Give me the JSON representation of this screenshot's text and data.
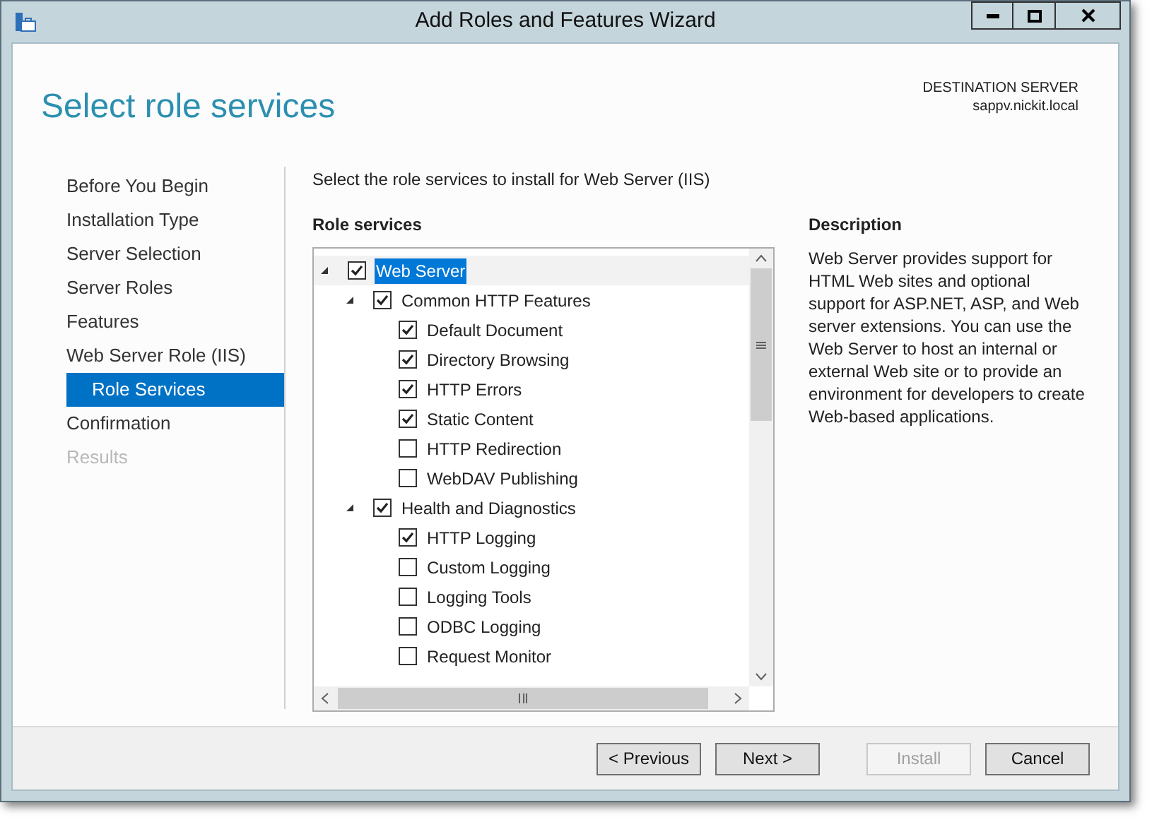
{
  "window": {
    "title": "Add Roles and Features Wizard"
  },
  "header": {
    "title": "Select role services",
    "destination_label": "DESTINATION SERVER",
    "destination_server": "sappv.nickit.local"
  },
  "nav": [
    {
      "label": "Before You Begin",
      "selected": false,
      "disabled": false
    },
    {
      "label": "Installation Type",
      "selected": false,
      "disabled": false
    },
    {
      "label": "Server Selection",
      "selected": false,
      "disabled": false
    },
    {
      "label": "Server Roles",
      "selected": false,
      "disabled": false
    },
    {
      "label": "Features",
      "selected": false,
      "disabled": false
    },
    {
      "label": "Web Server Role (IIS)",
      "selected": false,
      "disabled": false,
      "children": [
        {
          "label": "Role Services",
          "selected": true,
          "disabled": false
        }
      ]
    },
    {
      "label": "Confirmation",
      "selected": false,
      "disabled": false
    },
    {
      "label": "Results",
      "selected": false,
      "disabled": true
    }
  ],
  "instruction": "Select the role services to install for Web Server (IIS)",
  "role_services": {
    "heading": "Role services",
    "tree": [
      {
        "label": "Web Server",
        "checked": true,
        "expanded": true,
        "selected": true,
        "children": [
          {
            "label": "Common HTTP Features",
            "checked": true,
            "expanded": true,
            "selected": false,
            "children": [
              {
                "label": "Default Document",
                "checked": true,
                "selected": false
              },
              {
                "label": "Directory Browsing",
                "checked": true,
                "selected": false
              },
              {
                "label": "HTTP Errors",
                "checked": true,
                "selected": false
              },
              {
                "label": "Static Content",
                "checked": true,
                "selected": false
              },
              {
                "label": "HTTP Redirection",
                "checked": false,
                "selected": false
              },
              {
                "label": "WebDAV Publishing",
                "checked": false,
                "selected": false
              }
            ]
          },
          {
            "label": "Health and Diagnostics",
            "checked": true,
            "expanded": true,
            "selected": false,
            "children": [
              {
                "label": "HTTP Logging",
                "checked": true,
                "selected": false
              },
              {
                "label": "Custom Logging",
                "checked": false,
                "selected": false
              },
              {
                "label": "Logging Tools",
                "checked": false,
                "selected": false
              },
              {
                "label": "ODBC Logging",
                "checked": false,
                "selected": false
              },
              {
                "label": "Request Monitor",
                "checked": false,
                "selected": false
              }
            ]
          }
        ]
      }
    ]
  },
  "description": {
    "heading": "Description",
    "text": "Web Server provides support for HTML Web sites and optional support for ASP.NET, ASP, and Web server extensions. You can use the Web Server to host an internal or external Web site or to provide an environment for developers to create Web-based applications."
  },
  "buttons": [
    {
      "label": "< Previous",
      "disabled": false
    },
    {
      "label": "Next >",
      "disabled": false
    },
    {
      "label": "Install",
      "disabled": true
    },
    {
      "label": "Cancel",
      "disabled": false
    }
  ]
}
